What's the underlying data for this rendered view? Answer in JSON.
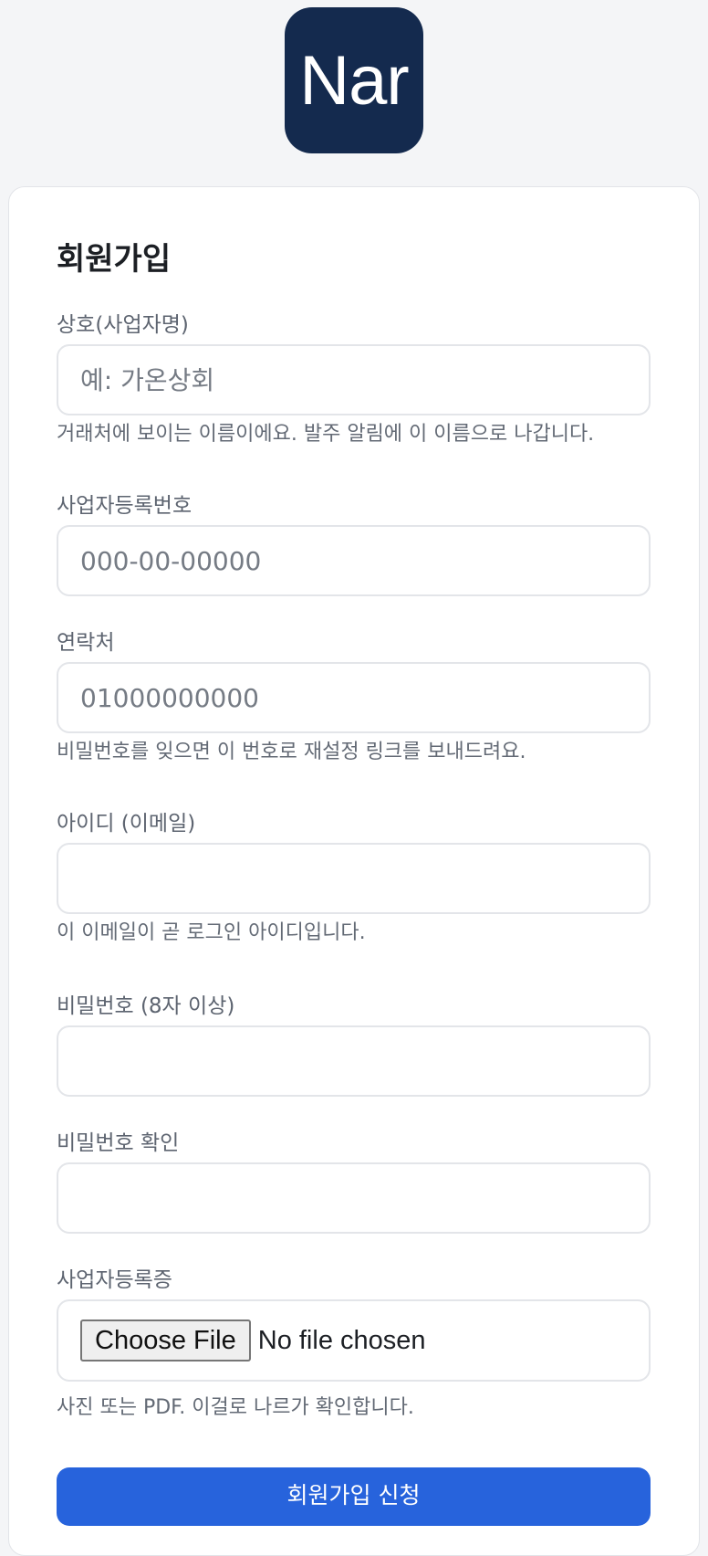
{
  "logo": {
    "text": "Nar"
  },
  "form": {
    "title": "회원가입",
    "business_name": {
      "label": "상호(사업자명)",
      "placeholder": "예: 가온상회",
      "hint": "거래처에 보이는 이름이에요. 발주 알림에 이 이름으로 나갑니다."
    },
    "business_number": {
      "label": "사업자등록번호",
      "placeholder": "000-00-00000"
    },
    "phone": {
      "label": "연락처",
      "placeholder": "01000000000",
      "hint": "비밀번호를 잊으면 이 번호로 재설정 링크를 보내드려요."
    },
    "email": {
      "label": "아이디 (이메일)",
      "value": "",
      "hint": "이 이메일이 곧 로그인 아이디입니다."
    },
    "password": {
      "label": "비밀번호 (8자 이상)",
      "value": ""
    },
    "password_confirm": {
      "label": "비밀번호 확인",
      "value": ""
    },
    "registration_certificate": {
      "label": "사업자등록증",
      "button_label": "Choose File",
      "status": "No file chosen",
      "hint": "사진 또는 PDF. 이걸로 나르가 확인합니다."
    },
    "submit_label": "회원가입 신청"
  }
}
